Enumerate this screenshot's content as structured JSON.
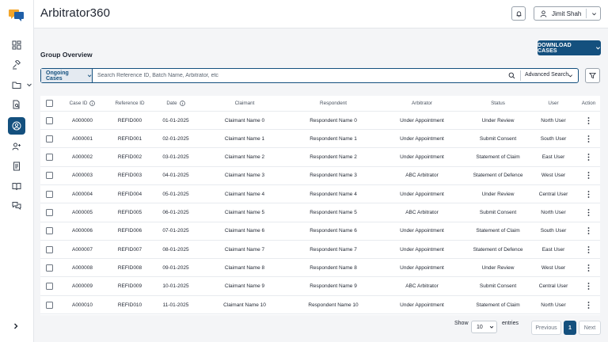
{
  "app": {
    "title": "Arbitrator360"
  },
  "colors": {
    "brand": "#14507e",
    "logo_orange": "#f2a52b",
    "logo_blue": "#1f5fa8"
  },
  "sidebar": {
    "items": [
      {
        "icon": "dashboard-icon",
        "active": false
      },
      {
        "icon": "gavel-icon",
        "active": false
      },
      {
        "icon": "folder-icon",
        "active": false,
        "expandable": true
      },
      {
        "icon": "file-search-icon",
        "active": false
      },
      {
        "icon": "user-circle-icon",
        "active": true
      },
      {
        "icon": "user-add-icon",
        "active": false
      },
      {
        "icon": "document-icon",
        "active": false
      },
      {
        "icon": "book-icon",
        "active": false
      },
      {
        "icon": "chat-icon",
        "active": false
      }
    ],
    "expand_icon": "chevron-right-icon"
  },
  "header": {
    "notification_icon": "bell-icon",
    "user_name": "Jimit Shah"
  },
  "main": {
    "section_title": "Group Overview",
    "download_label": "DOWNLOAD CASES",
    "filter_dropdown": "Ongoing Cases",
    "search_placeholder": "Search Reference ID, Batch Name, Arbitrator, etc",
    "advanced_search": "Advanced Search"
  },
  "table": {
    "columns": [
      "Case ID",
      "Reference ID",
      "Date",
      "Claimant",
      "Respondent",
      "Arbitrator",
      "Status",
      "User",
      "Action"
    ],
    "rows": [
      [
        "A000000",
        "REFID000",
        "01-01-2025",
        "Claimant Name 0",
        "Respondent Name 0",
        "Under Appointment",
        "Under Review",
        "North User"
      ],
      [
        "A000001",
        "REFID001",
        "02-01-2025",
        "Claimant Name 1",
        "Respondent Name 1",
        "Under Appointment",
        "Submit Consent",
        "South User"
      ],
      [
        "A000002",
        "REFID002",
        "03-01-2025",
        "Claimant Name 2",
        "Respondent Name 2",
        "Under Appointment",
        "Statement of Claim",
        "East User"
      ],
      [
        "A000003",
        "REFID003",
        "04-01-2025",
        "Claimant Name 3",
        "Respondent Name 3",
        "ABC Arbitrator",
        "Statement of Defence",
        "West User"
      ],
      [
        "A000004",
        "REFID004",
        "05-01-2025",
        "Claimant Name 4",
        "Respondent Name 4",
        "Under Appointment",
        "Under Review",
        "Central User"
      ],
      [
        "A000005",
        "REFID005",
        "06-01-2025",
        "Claimant Name 5",
        "Respondent Name 5",
        "ABC Arbitrator",
        "Submit Consent",
        "North User"
      ],
      [
        "A000006",
        "REFID006",
        "07-01-2025",
        "Claimant Name 6",
        "Respondent Name 6",
        "Under Appointment",
        "Statement of Claim",
        "South User"
      ],
      [
        "A000007",
        "REFID007",
        "08-01-2025",
        "Claimant Name 7",
        "Respondent Name 7",
        "Under Appointment",
        "Statement of Defence",
        "East User"
      ],
      [
        "A000008",
        "REFID008",
        "09-01-2025",
        "Claimant Name 8",
        "Respondent Name 8",
        "Under Appointment",
        "Under Review",
        "West User"
      ],
      [
        "A000009",
        "REFID009",
        "10-01-2025",
        "Claimant Name 9",
        "Respondent Name 9",
        "ABC Arbitrator",
        "Submit Consent",
        "Central User"
      ],
      [
        "A000010",
        "REFID010",
        "11-01-2025",
        "Claimant Name 10",
        "Respondent Name 10",
        "Under Appointment",
        "Statement of Claim",
        "North User"
      ]
    ]
  },
  "pagination": {
    "show_label": "Show",
    "page_size": "10",
    "entries_label": "entries",
    "previous_label": "Previous",
    "current_page": "1",
    "next_label": "Next"
  }
}
